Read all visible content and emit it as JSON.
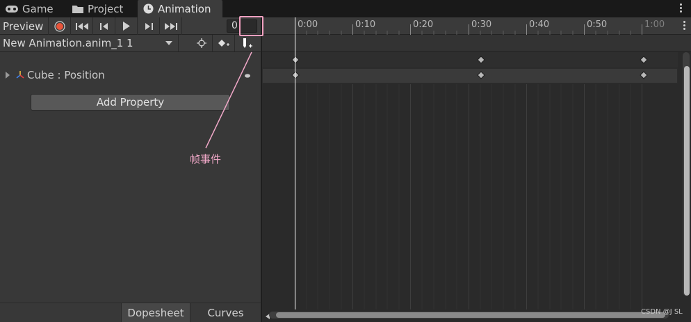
{
  "tabs": [
    {
      "label": "Game",
      "icon": "game-controller-icon"
    },
    {
      "label": "Project",
      "icon": "folder-icon"
    },
    {
      "label": "Animation",
      "icon": "clock-icon",
      "active": true
    }
  ],
  "toolbar": {
    "preview_label": "Preview",
    "frame_value": "0",
    "clip_name": "New Animation.anim_1 1"
  },
  "properties": [
    {
      "label": "Cube : Position",
      "icon": "transform-gizmo-icon"
    }
  ],
  "add_property_label": "Add Property",
  "bottom_tabs": [
    "Dopesheet",
    "Curves"
  ],
  "annotation_text": "帧事件",
  "timeline": {
    "ticks": [
      "0:00",
      "0:10",
      "0:20",
      "0:30",
      "0:40",
      "0:50",
      "1:00"
    ],
    "keyframes": [
      "0:00",
      "0:30",
      "0:56"
    ]
  },
  "watermark": "CSDN @J SL",
  "colors": {
    "record": "#e8553b",
    "annotation": "#f0a8c8",
    "playhead": "#ffffff"
  }
}
